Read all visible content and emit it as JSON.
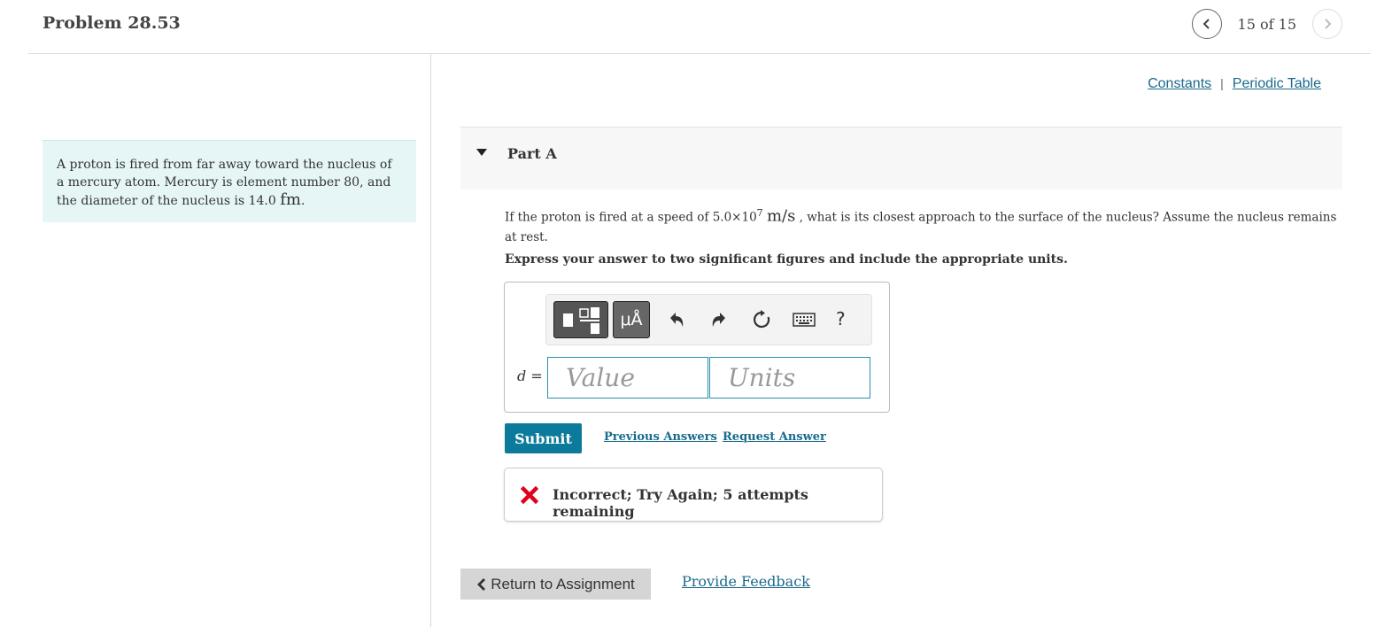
{
  "header": {
    "title": "Problem 28.53",
    "nav_count": "15 of 15"
  },
  "intro": {
    "text": "A proton is fired from far away toward the nucleus of a mercury atom. Mercury is element number 80, and the diameter of the nucleus is 14.0 ",
    "unit": "fm",
    "end": "."
  },
  "links": {
    "constants": "Constants",
    "separator": "|",
    "periodic_table": "Periodic Table"
  },
  "part": {
    "title": "Part A"
  },
  "question": {
    "text_before": "If the proton is fired at a speed of 5.0×10",
    "exponent": "7",
    "unit": "m/s",
    "text_after": " , what is its closest approach to the surface of the nucleus? Assume the nucleus remains at rest."
  },
  "instruction": "Express your answer to two significant figures and include the appropriate units.",
  "answer": {
    "variable": "d",
    "equals": " =",
    "value_placeholder": "Value",
    "units_placeholder": "Units",
    "units_tool_label": "μÅ",
    "help_label": "?"
  },
  "actions": {
    "submit": "Submit",
    "previous_answers": "Previous Answers",
    "request_answer": "Request Answer"
  },
  "feedback": {
    "message": "Incorrect; Try Again; 5 attempts remaining",
    "status_color": "#e0001b"
  },
  "footer": {
    "return": "Return to Assignment",
    "provide_feedback": "Provide Feedback"
  },
  "colors": {
    "accent": "#0c7a9a",
    "link": "#1a6a8d",
    "intro_bg": "#e6f6f6"
  },
  "icons": {
    "nav_prev": "chevron-left-icon",
    "nav_next": "chevron-right-icon",
    "templates": "templates-icon",
    "undo": "undo-icon",
    "redo": "redo-icon",
    "reset": "reset-icon",
    "keyboard": "keyboard-icon",
    "help": "help-icon",
    "incorrect": "x-icon",
    "return": "chevron-left-icon"
  }
}
